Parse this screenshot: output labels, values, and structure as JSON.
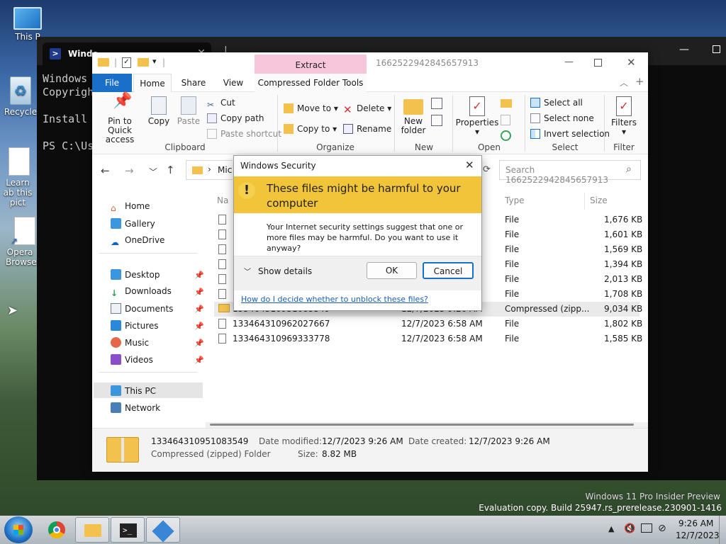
{
  "desktop": {
    "icons": [
      {
        "label": "This P",
        "icon": "monitor-icon"
      },
      {
        "label": "Recycle",
        "icon": "recycle-bin-icon"
      },
      {
        "label": "Learn ab this pict",
        "icon": "document-icon"
      },
      {
        "label": "Opera Browse",
        "icon": "shortcut-icon"
      }
    ]
  },
  "terminal": {
    "tab_title": "Windo",
    "lines": [
      "Windows",
      "Copyrigh",
      "",
      "Install",
      "",
      "PS C:\\Us"
    ]
  },
  "explorer": {
    "title": "1662522942845657913",
    "context_tab": "Extract",
    "tabs": [
      "File",
      "Home",
      "Share",
      "View",
      "Compressed Folder Tools"
    ],
    "active_tab": "Home",
    "ribbon": {
      "clipboard": {
        "label": "Clipboard",
        "pin": "Pin to Quick access",
        "copy": "Copy",
        "paste": "Paste",
        "cut": "Cut",
        "copy_path": "Copy path",
        "paste_shortcut": "Paste shortcut"
      },
      "organize": {
        "label": "Organize",
        "move_to": "Move to",
        "copy_to": "Copy to",
        "delete": "Delete",
        "rename": "Rename"
      },
      "new": {
        "label": "New",
        "new_folder": "New folder"
      },
      "open": {
        "label": "Open",
        "properties": "Properties"
      },
      "select": {
        "label": "Select",
        "select_all": "Select all",
        "select_none": "Select none",
        "invert": "Invert selection"
      },
      "filter": {
        "label": "Filter",
        "filters": "Filters"
      }
    },
    "address": {
      "crumb": "Mic",
      "search_placeholder": "Search 1662522942845657913"
    },
    "nav": {
      "home": "Home",
      "gallery": "Gallery",
      "onedrive": "OneDrive",
      "desktop": "Desktop",
      "downloads": "Downloads",
      "documents": "Documents",
      "pictures": "Pictures",
      "music": "Music",
      "videos": "Videos",
      "this_pc": "This PC",
      "network": "Network"
    },
    "columns": {
      "name": "Na",
      "type": "Type",
      "size": "Size"
    },
    "rows": [
      {
        "name": "",
        "date": "",
        "type": "File",
        "size": "1,676 KB"
      },
      {
        "name": "",
        "date": "",
        "type": "File",
        "size": "1,601 KB"
      },
      {
        "name": "",
        "date": "",
        "type": "File",
        "size": "1,569 KB"
      },
      {
        "name": "",
        "date": "",
        "type": "File",
        "size": "1,394 KB"
      },
      {
        "name": "",
        "date": "",
        "type": "File",
        "size": "2,013 KB"
      },
      {
        "name": "",
        "date": "",
        "type": "File",
        "size": "1,708 KB"
      },
      {
        "name": "133464310951083549",
        "date": "12/7/2023 9:26 AM",
        "type": "Compressed (zipp...",
        "size": "9,034 KB"
      },
      {
        "name": "133464310962027667",
        "date": "12/7/2023 6:58 AM",
        "type": "File",
        "size": "1,802 KB"
      },
      {
        "name": "133464310969333778",
        "date": "12/7/2023 6:58 AM",
        "type": "File",
        "size": "1,585 KB"
      }
    ],
    "details": {
      "name": "133464310951083549",
      "kind": "Compressed (zipped) Folder",
      "date_modified_label": "Date modified:",
      "date_modified": "12/7/2023 9:26 AM",
      "size_label": "Size:",
      "size": "8.82 MB",
      "date_created_label": "Date created:",
      "date_created": "12/7/2023 9:26 AM"
    }
  },
  "dialog": {
    "title": "Windows Security",
    "heading": "These files might be harmful to your computer",
    "message": "Your Internet security settings suggest that one or more files may be harmful. Do you want to use it anyway?",
    "show_details": "Show details",
    "ok": "OK",
    "cancel": "Cancel",
    "link": "How do I decide whether to unblock these files?"
  },
  "watermark": {
    "line1": "Windows 11 Pro Insider Preview",
    "line2": "Evaluation copy. Build 25947.rs_prerelease.230901-1416"
  },
  "taskbar": {
    "time": "9:26 AM",
    "date": "12/7/2023"
  }
}
